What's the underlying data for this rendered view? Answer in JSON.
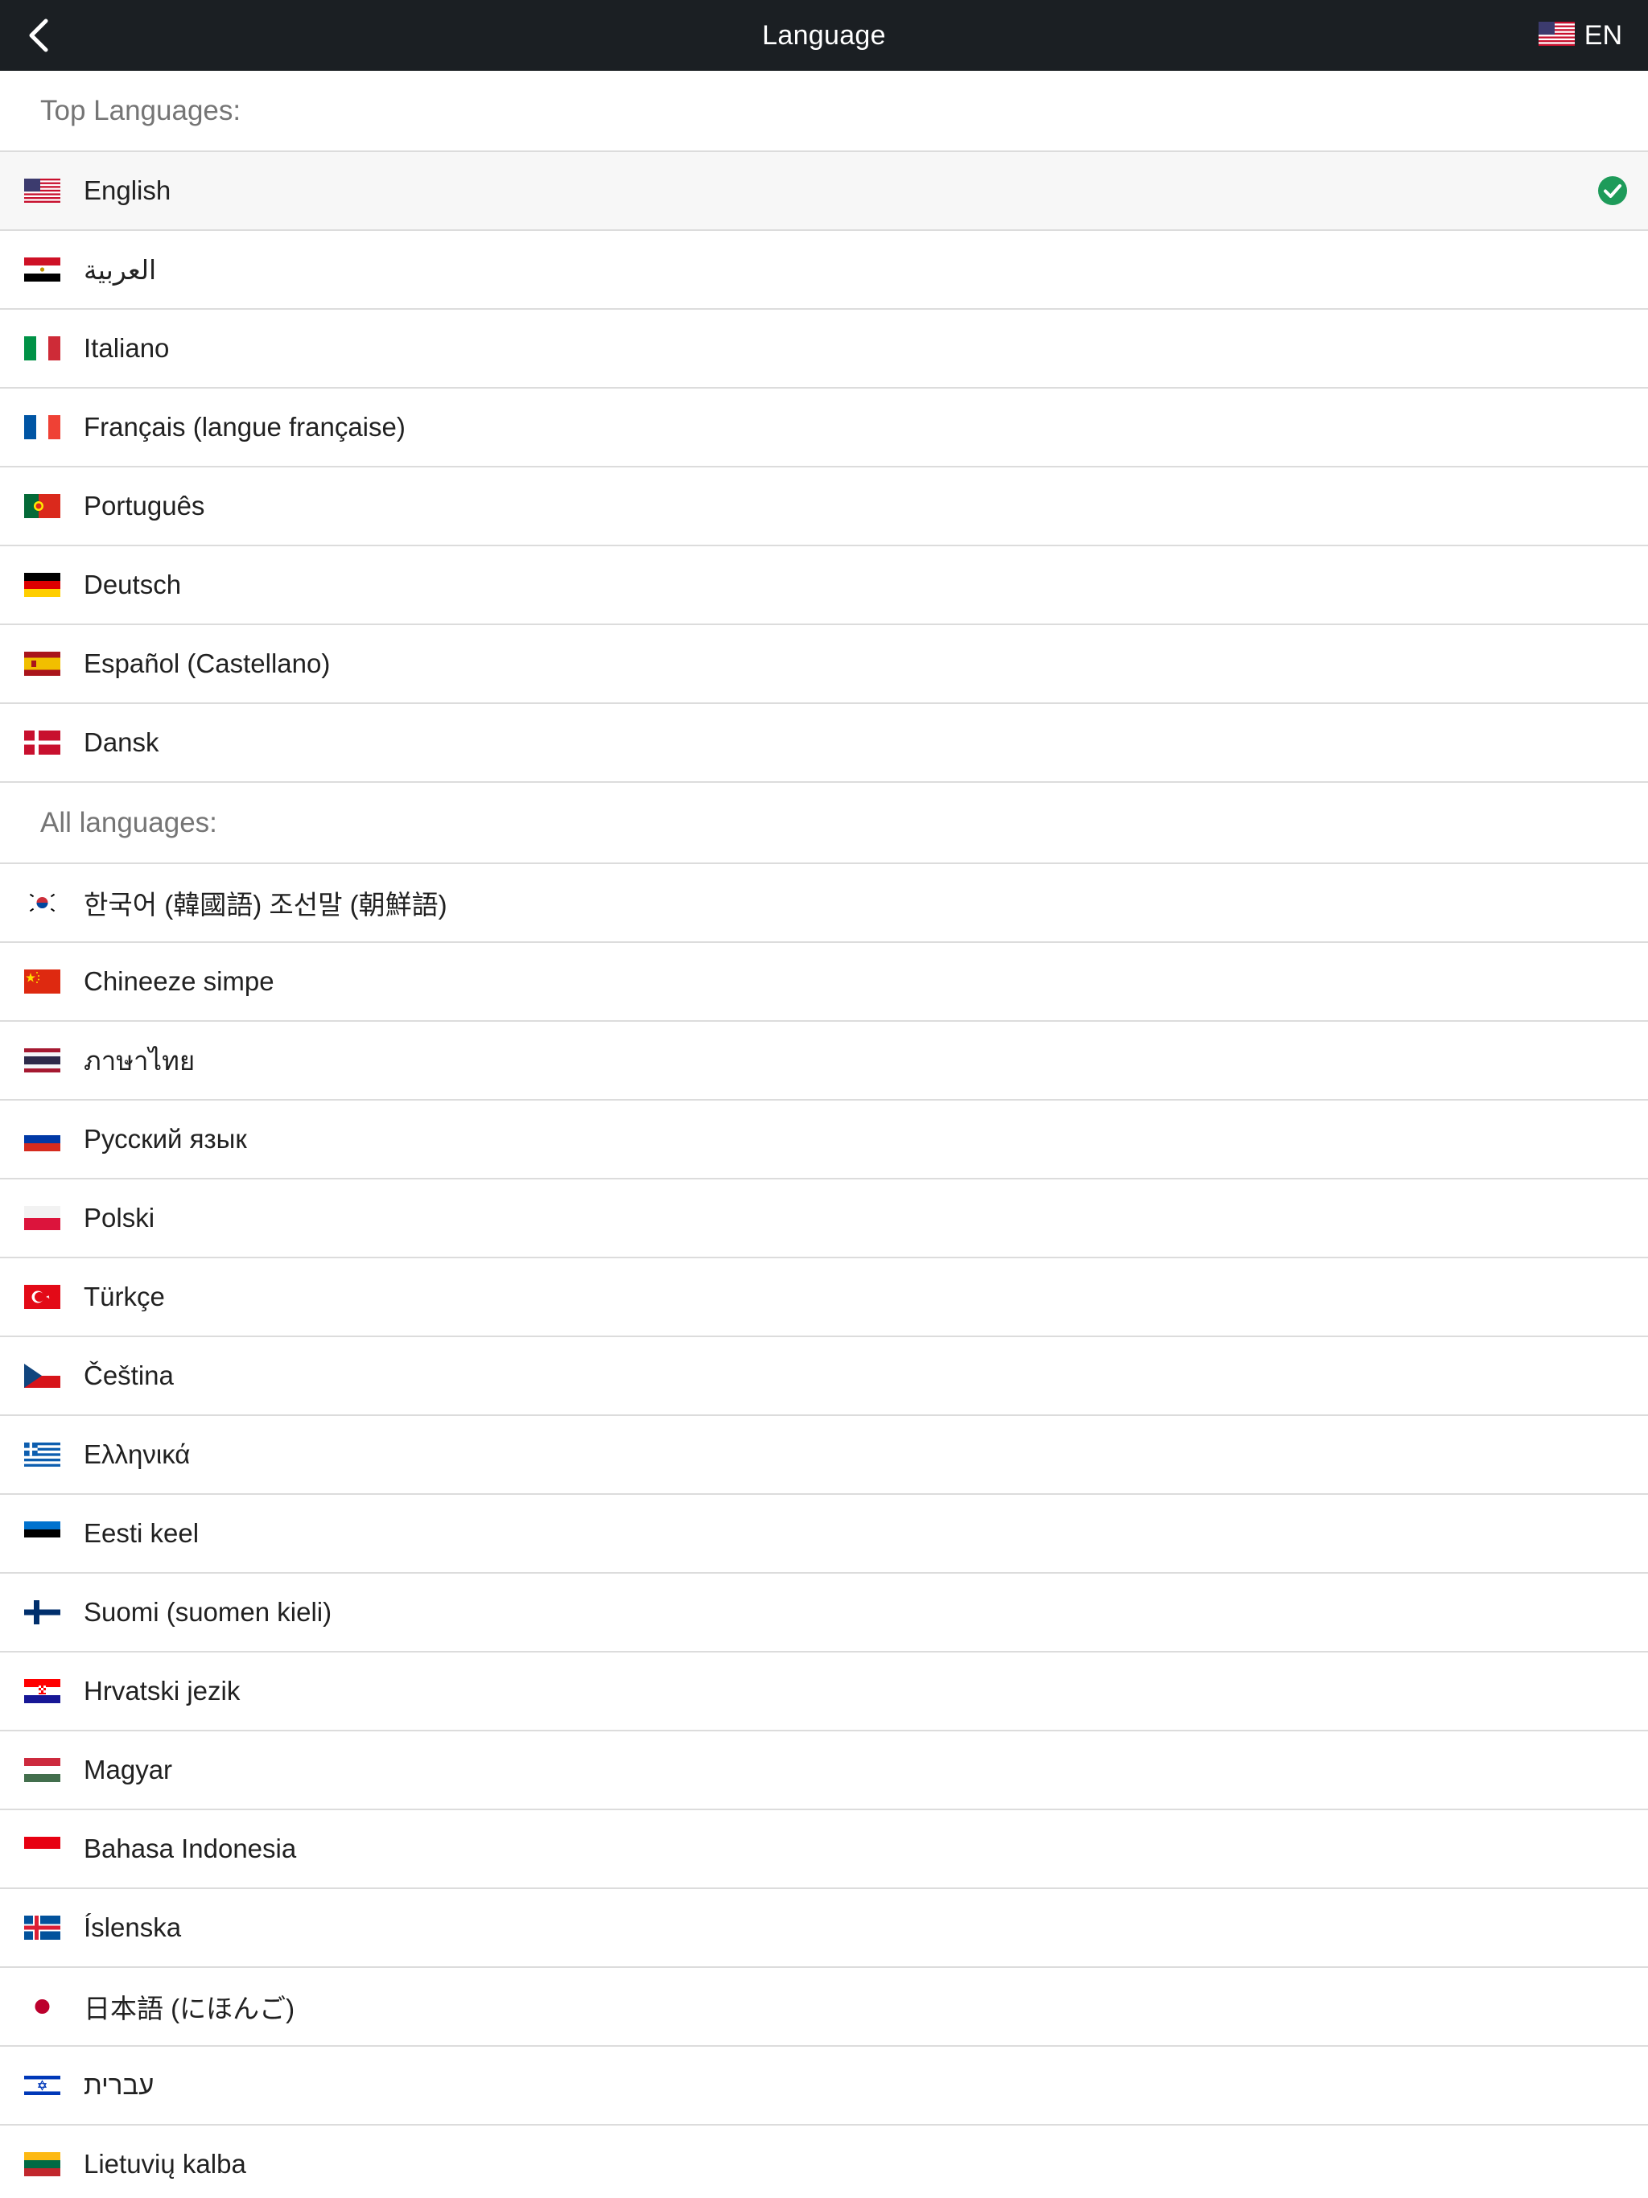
{
  "header": {
    "title": "Language",
    "current_code": "EN"
  },
  "sections": {
    "top": "Top Languages:",
    "all": "All languages:"
  },
  "colors": {
    "header_bg": "#1b1f23",
    "check": "#1e9b5a",
    "divider": "#dcdcdc"
  },
  "top_languages": [
    {
      "flag": "us-flag-icon",
      "label": "English",
      "selected": true
    },
    {
      "flag": "egypt-flag-icon",
      "label": "العربية",
      "selected": false
    },
    {
      "flag": "italy-flag-icon",
      "label": "Italiano",
      "selected": false
    },
    {
      "flag": "france-flag-icon",
      "label": "Français (langue française)",
      "selected": false
    },
    {
      "flag": "portugal-flag-icon",
      "label": "Português",
      "selected": false
    },
    {
      "flag": "germany-flag-icon",
      "label": "Deutsch",
      "selected": false
    },
    {
      "flag": "spain-flag-icon",
      "label": "Español (Castellano)",
      "selected": false
    },
    {
      "flag": "denmark-flag-icon",
      "label": "Dansk",
      "selected": false
    }
  ],
  "all_languages": [
    {
      "flag": "south-korea-flag-icon",
      "label": "한국어 (韓國語) 조선말 (朝鮮語)"
    },
    {
      "flag": "china-flag-icon",
      "label": "Chineeze simpe"
    },
    {
      "flag": "thailand-flag-icon",
      "label": "ภาษาไทย"
    },
    {
      "flag": "russia-flag-icon",
      "label": "Русский язык"
    },
    {
      "flag": "poland-flag-icon",
      "label": "Polski"
    },
    {
      "flag": "turkey-flag-icon",
      "label": "Türkçe"
    },
    {
      "flag": "czech-flag-icon",
      "label": "Čeština"
    },
    {
      "flag": "greece-flag-icon",
      "label": "Ελληνικά"
    },
    {
      "flag": "estonia-flag-icon",
      "label": "Eesti keel"
    },
    {
      "flag": "finland-flag-icon",
      "label": "Suomi (suomen kieli)"
    },
    {
      "flag": "croatia-flag-icon",
      "label": "Hrvatski jezik"
    },
    {
      "flag": "hungary-flag-icon",
      "label": "Magyar"
    },
    {
      "flag": "indonesia-flag-icon",
      "label": "Bahasa Indonesia"
    },
    {
      "flag": "iceland-flag-icon",
      "label": "Íslenska"
    },
    {
      "flag": "japan-flag-icon",
      "label": "日本語 (にほんご)"
    },
    {
      "flag": "israel-flag-icon",
      "label": "עברית"
    },
    {
      "flag": "lithuania-flag-icon",
      "label": "Lietuvių kalba"
    }
  ]
}
